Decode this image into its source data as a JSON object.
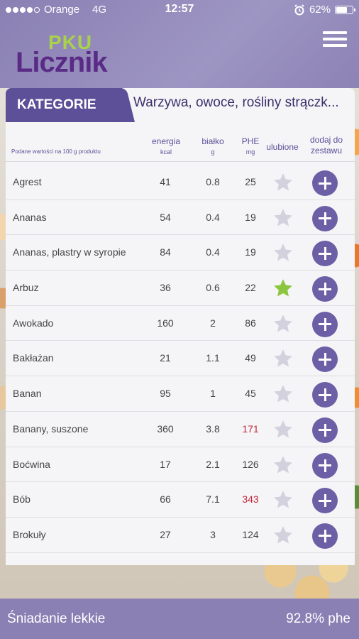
{
  "status_bar": {
    "carrier": "Orange",
    "network": "4G",
    "time": "12:57",
    "battery": "62%",
    "battery_level": 0.62,
    "signal_bars": 4,
    "icons": [
      "alarm-icon",
      "battery-icon"
    ]
  },
  "app": {
    "logo_top": "PKU",
    "logo_bottom": "Licznik"
  },
  "tabs": {
    "kategorie_label": "KATEGORIE",
    "category_title": "Warzywa, owoce, rośliny strączk..."
  },
  "table": {
    "note": "Podane wartości na 100 g produktu",
    "columns": {
      "energy": "energia",
      "energy_unit": "kcal",
      "protein": "białko",
      "protein_unit": "g",
      "phe": "PHE",
      "phe_unit": "mg",
      "favorite": "ulubione",
      "add_line1": "dodaj do",
      "add_line2": "zestawu"
    },
    "rows": [
      {
        "name": "Agrest",
        "energy": "41",
        "protein": "0.8",
        "phe": "25",
        "phe_high": false,
        "favorite": false
      },
      {
        "name": "Ananas",
        "energy": "54",
        "protein": "0.4",
        "phe": "19",
        "phe_high": false,
        "favorite": false
      },
      {
        "name": "Ananas, plastry w syropie",
        "energy": "84",
        "protein": "0.4",
        "phe": "19",
        "phe_high": false,
        "favorite": false
      },
      {
        "name": "Arbuz",
        "energy": "36",
        "protein": "0.6",
        "phe": "22",
        "phe_high": false,
        "favorite": true
      },
      {
        "name": "Awokado",
        "energy": "160",
        "protein": "2",
        "phe": "86",
        "phe_high": false,
        "favorite": false
      },
      {
        "name": "Bakłażan",
        "energy": "21",
        "protein": "1.1",
        "phe": "49",
        "phe_high": false,
        "favorite": false
      },
      {
        "name": "Banan",
        "energy": "95",
        "protein": "1",
        "phe": "45",
        "phe_high": false,
        "favorite": false
      },
      {
        "name": "Banany, suszone",
        "energy": "360",
        "protein": "3.8",
        "phe": "171",
        "phe_high": true,
        "favorite": false
      },
      {
        "name": "Boćwina",
        "energy": "17",
        "protein": "2.1",
        "phe": "126",
        "phe_high": false,
        "favorite": false
      },
      {
        "name": "Bób",
        "energy": "66",
        "protein": "7.1",
        "phe": "343",
        "phe_high": true,
        "favorite": false
      },
      {
        "name": "Brokuły",
        "energy": "27",
        "protein": "3",
        "phe": "124",
        "phe_high": false,
        "favorite": false
      }
    ]
  },
  "bottom_bar": {
    "meal_name": "Śniadanie lekkie",
    "phe_percent": "92.8% phe"
  },
  "colors": {
    "accent": "#5d4f98",
    "header": "#8a80b4",
    "star_active": "#8cc63f",
    "star_inactive": "#d3d1de",
    "phe_high": "#c0273b"
  }
}
